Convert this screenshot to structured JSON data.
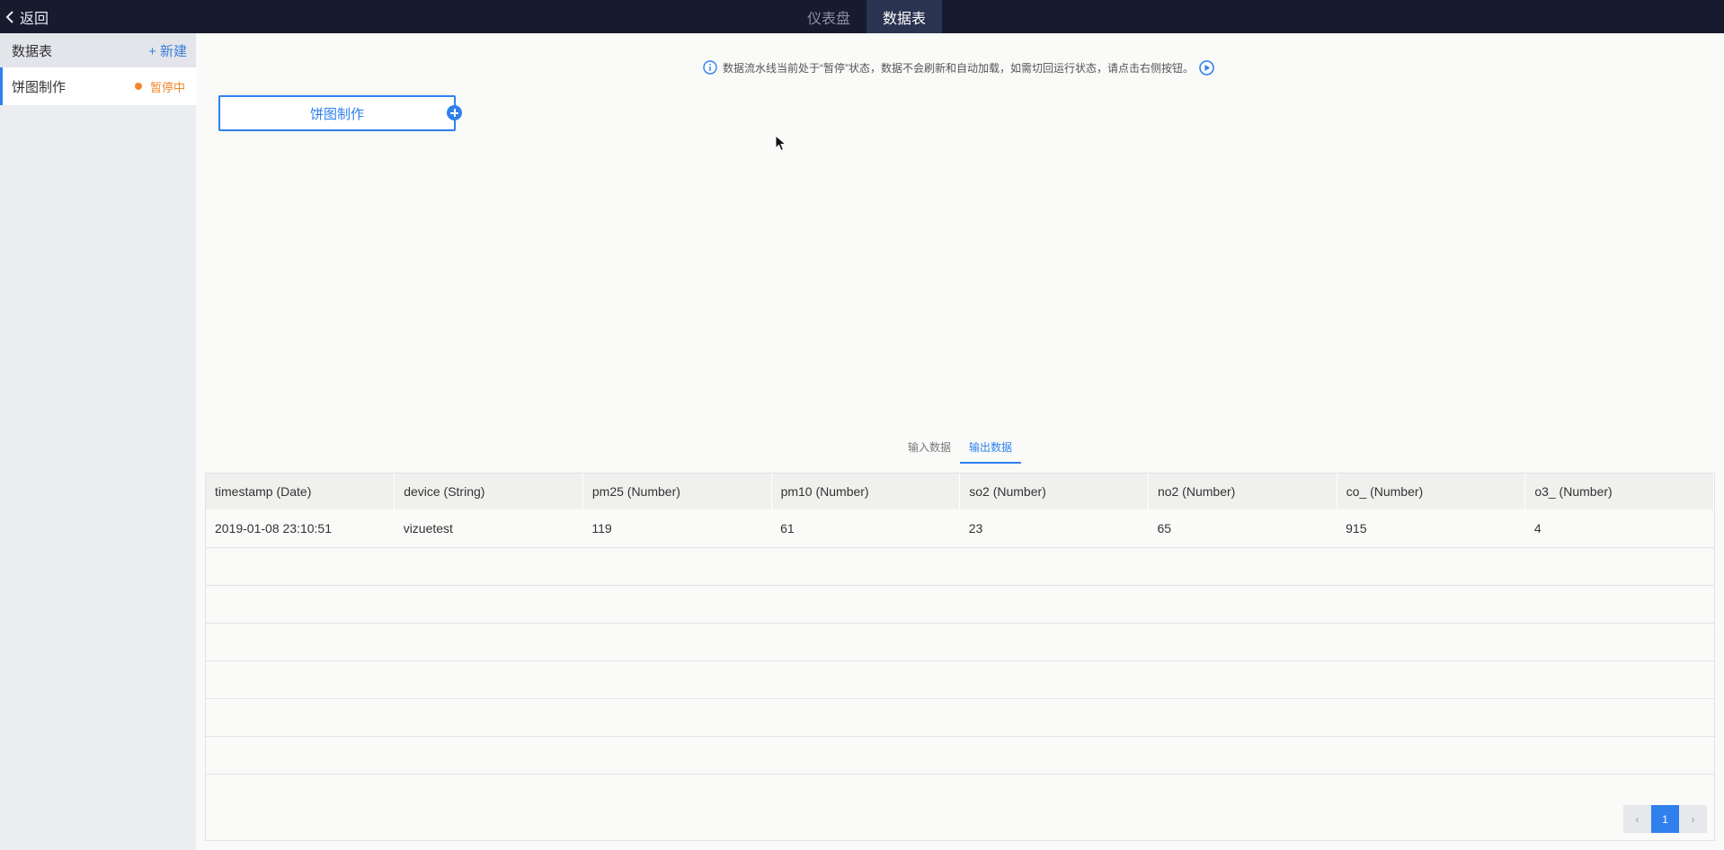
{
  "topbar": {
    "back_label": "返回",
    "tabs": [
      {
        "label": "仪表盘",
        "active": false
      },
      {
        "label": "数据表",
        "active": true
      }
    ]
  },
  "sidebar": {
    "title": "数据表",
    "new_label": "+ 新建",
    "items": [
      {
        "label": "饼图制作",
        "status": "暂停中"
      }
    ]
  },
  "notice": {
    "text": "数据流水线当前处于“暂停”状态，数据不会刷新和自动加载，如需切回运行状态，请点击右侧按钮。"
  },
  "pipeline": {
    "node_label": "饼图制作"
  },
  "data_tabs": [
    {
      "label": "输入数据",
      "active": false
    },
    {
      "label": "输出数据",
      "active": true
    }
  ],
  "table": {
    "columns": [
      "timestamp (Date)",
      "device (String)",
      "pm25 (Number)",
      "pm10 (Number)",
      "so2 (Number)",
      "no2 (Number)",
      "co_ (Number)",
      "o3_ (Number)"
    ],
    "rows": [
      [
        "2019-01-08 23:10:51",
        "vizuetest",
        "119",
        "61",
        "23",
        "65",
        "915",
        "4"
      ]
    ]
  },
  "pagination": {
    "prev": "‹",
    "current": "1",
    "next": "›"
  },
  "colors": {
    "accent": "#2f80ed",
    "topbar_bg": "#161b2e",
    "paused": "#f0882b"
  }
}
